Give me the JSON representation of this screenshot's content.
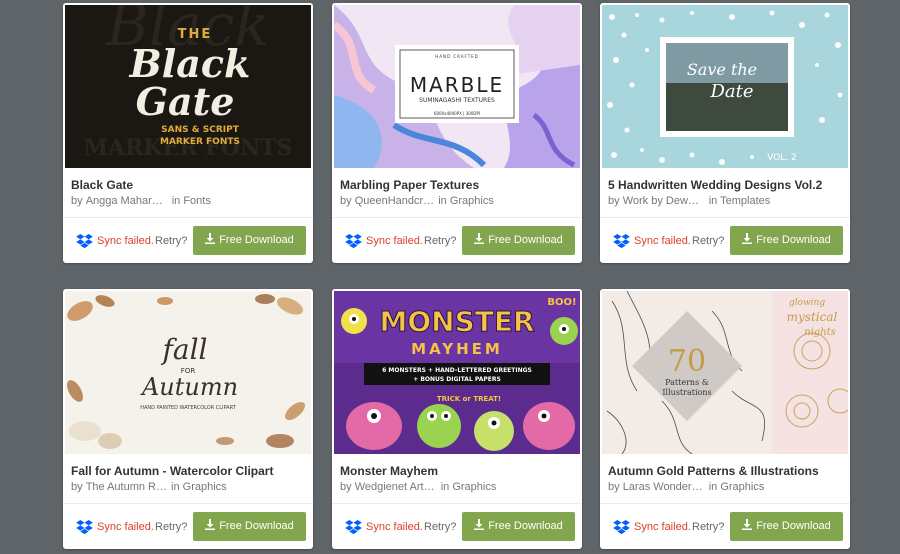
{
  "cards": [
    {
      "title": "Black Gate",
      "author": "Angga Mahard…",
      "category": "Fonts",
      "sync": "Sync failed.",
      "retry": "Retry?",
      "download": "Free Download",
      "art": {
        "l1": "THE",
        "l2": "Black",
        "l3": "Gate",
        "l4": "SANS & SCRIPT",
        "l5": "MARKER FONTS"
      }
    },
    {
      "title": "Marbling Paper Textures",
      "author": "QueenHandcr…",
      "category": "Graphics",
      "sync": "Sync failed.",
      "retry": "Retry?",
      "download": "Free Download",
      "art": {
        "l1": "HAND CRAFTED",
        "l2": "MARBLE",
        "l3": "SUMINAGASHI TEXTURES",
        "l4": "6000x4000PX | 300DPI"
      }
    },
    {
      "title": "5 Handwritten Wedding Designs Vol.2",
      "author": "Work by Dewb…",
      "category": "Templates",
      "sync": "Sync failed.",
      "retry": "Retry?",
      "download": "Free Download",
      "art": {
        "l1": "Save the",
        "l2": "Date",
        "l3": "VOL. 2"
      }
    },
    {
      "title": "Fall for Autumn - Watercolor Clipart",
      "author": "The Autumn R…",
      "category": "Graphics",
      "sync": "Sync failed.",
      "retry": "Retry?",
      "download": "Free Download",
      "art": {
        "l1": "fall",
        "l2": "FOR",
        "l3": "Autumn",
        "l4": "HAND PAINTED WATERCOLOR CLIPART"
      }
    },
    {
      "title": "Monster Mayhem",
      "author": "Wedgienet Art …",
      "category": "Graphics",
      "sync": "Sync failed.",
      "retry": "Retry?",
      "download": "Free Download",
      "art": {
        "l1": "MONSTER",
        "l2": "MAYHEM",
        "l3": "6 MONSTERS + HAND-LETTERED GREETINGS",
        "l4": "+ BONUS DIGITAL PAPERS",
        "l5": "BOO!",
        "l6": "TRICK or TREAT!"
      }
    },
    {
      "title": "Autumn Gold Patterns & Illustrations",
      "author": "Laras Wonderl…",
      "category": "Graphics",
      "sync": "Sync failed.",
      "retry": "Retry?",
      "download": "Free Download",
      "art": {
        "l1": "70",
        "l2": "Patterns &",
        "l3": "Illustrations",
        "l4": "glowing",
        "l5": "mystical",
        "l6": "nights"
      }
    }
  ],
  "labels": {
    "by": "by",
    "in": "in"
  },
  "colors": {
    "accent": "#82a64e",
    "error": "#d9412c",
    "background": "#5f6468",
    "dropbox": "#0061fe"
  }
}
